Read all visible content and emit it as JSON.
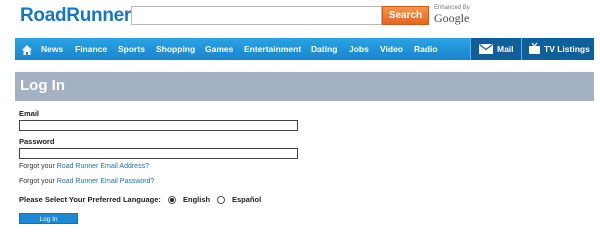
{
  "header": {
    "logo": "RoadRunner",
    "search": {
      "value": "",
      "placeholder": ""
    },
    "search_button": "Search",
    "enhanced_by": "Enhanced By",
    "google": "Google"
  },
  "nav": {
    "home_icon": "home-icon",
    "items": [
      "News",
      "Finance",
      "Sports",
      "Shopping",
      "Games",
      "Entertainment",
      "Dating",
      "Jobs",
      "Video",
      "Radio"
    ],
    "mail": "Mail",
    "mail_icon": "envelope-icon",
    "tv": "TV Listings",
    "tv_icon": "tv-icon"
  },
  "login": {
    "title": "Log In",
    "email_label": "Email",
    "email_value": "",
    "password_label": "Password",
    "password_value": "",
    "forgot_prefix_1": "Forgot your ",
    "forgot_link_1": "Road Runner Email Address?",
    "forgot_prefix_2": "Forgot your ",
    "forgot_link_2": "Road Runner Email Password?",
    "language_prompt": "Please Select Your Preferred Language:",
    "languages": [
      {
        "label": "English",
        "selected": true
      },
      {
        "label": "Español",
        "selected": false
      }
    ],
    "button": "Log In"
  },
  "colors": {
    "brand_blue": "#1677c8",
    "nav_blue": "#1a84cc",
    "search_orange": "#e8641c",
    "panel_gray": "#a3b1c2",
    "link_blue": "#1a6fb8"
  }
}
